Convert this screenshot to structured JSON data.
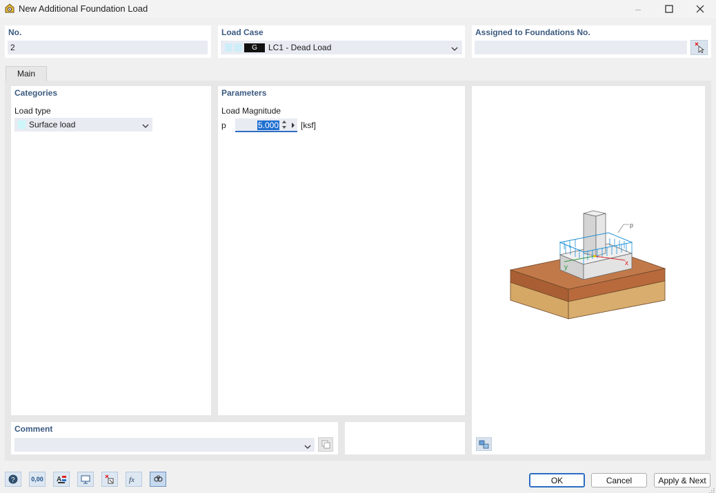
{
  "window": {
    "title": "New Additional Foundation Load",
    "controls": {
      "minimize": "–",
      "maximize": "☐",
      "close": "✕"
    }
  },
  "header": {
    "no": {
      "label": "No.",
      "value": "2"
    },
    "load_case": {
      "label": "Load Case",
      "badge": "G",
      "value": "LC1 - Dead Load"
    },
    "assigned": {
      "label": "Assigned to Foundations No.",
      "value": ""
    }
  },
  "tabs": [
    {
      "label": "Main",
      "active": true
    }
  ],
  "categories": {
    "title": "Categories",
    "load_type_label": "Load type",
    "load_type_value": "Surface load"
  },
  "parameters": {
    "title": "Parameters",
    "magnitude_label": "Load Magnitude",
    "symbol": "p",
    "value": "5.000",
    "unit": "[ksf]"
  },
  "figure": {
    "labels": {
      "p": "p",
      "x": "x",
      "y": "y"
    }
  },
  "comment": {
    "label": "Comment",
    "value": ""
  },
  "buttons": {
    "ok": "OK",
    "cancel": "Cancel",
    "apply_next": "Apply & Next"
  },
  "toolbar_icons": [
    "help-icon",
    "units-icon",
    "display-icon",
    "view-icon",
    "select-icon",
    "function-icon",
    "settings-icon"
  ],
  "toolbar_text": {
    "units": "0,00"
  },
  "colors": {
    "accent": "#3c5a80",
    "load_arrows": "#1e90d6",
    "soil_top": "#c2794a",
    "soil_body": "#d6a866"
  }
}
